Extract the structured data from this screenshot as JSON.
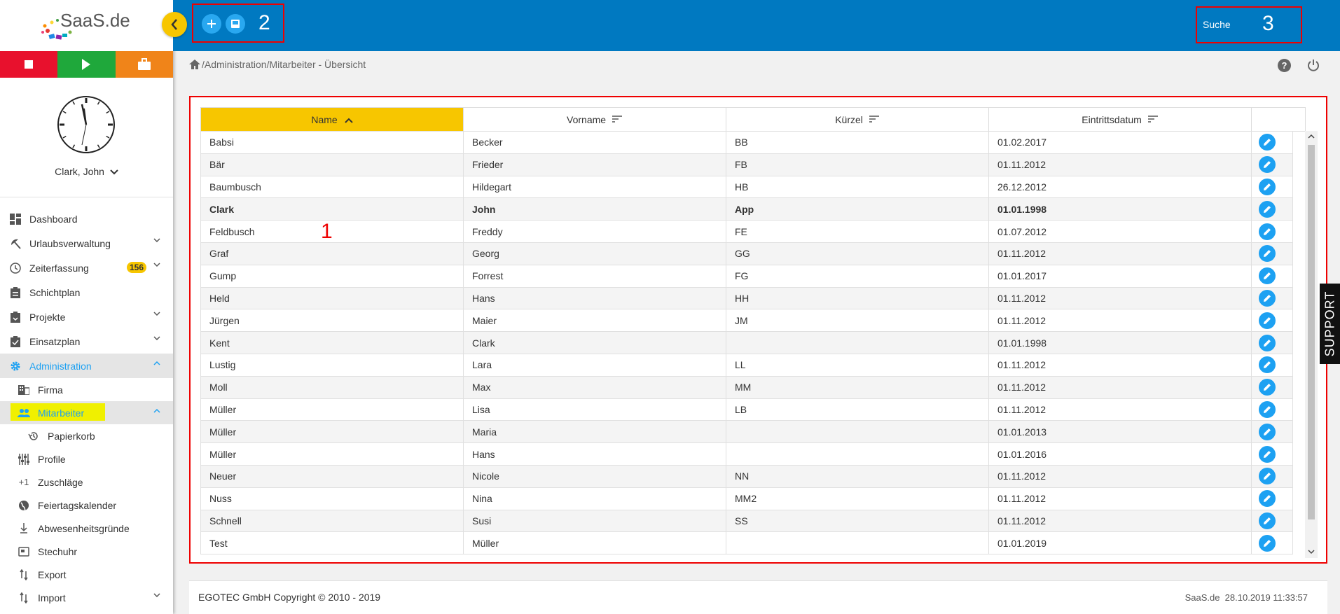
{
  "app": {
    "logo_text": "SaaS.de"
  },
  "user": {
    "name": "Clark, John"
  },
  "nav": {
    "items": [
      {
        "label": "Dashboard"
      },
      {
        "label": "Urlaubsverwaltung"
      },
      {
        "label": "Zeiterfassung",
        "badge": "156"
      },
      {
        "label": "Schichtplan"
      },
      {
        "label": "Projekte"
      },
      {
        "label": "Einsatzplan"
      },
      {
        "label": "Administration"
      }
    ],
    "sub_items": [
      {
        "label": "Firma"
      },
      {
        "label": "Mitarbeiter"
      },
      {
        "label": "Papierkorb"
      },
      {
        "label": "Profile"
      },
      {
        "label": "Zuschläge"
      },
      {
        "label": "Feiertagskalender"
      },
      {
        "label": "Abwesenheitsgründe"
      },
      {
        "label": "Stechuhr"
      },
      {
        "label": "Export"
      },
      {
        "label": "Import"
      }
    ]
  },
  "topbar": {
    "marker_2": "2",
    "marker_3": "3",
    "search_placeholder": "Suche"
  },
  "breadcrumb": {
    "text": "/Administration/Mitarbeiter - Übersicht"
  },
  "table": {
    "marker_1": "1",
    "columns": [
      "Name",
      "Vorname",
      "Kürzel",
      "Eintrittsdatum"
    ],
    "rows": [
      [
        "Babsi",
        "Becker",
        "BB",
        "01.02.2017"
      ],
      [
        "Bär",
        "Frieder",
        "FB",
        "01.11.2012"
      ],
      [
        "Baumbusch",
        "Hildegart",
        "HB",
        "26.12.2012"
      ],
      [
        "Clark",
        "John",
        "App",
        "01.01.1998"
      ],
      [
        "Feldbusch",
        "Freddy",
        "FE",
        "01.07.2012"
      ],
      [
        "Graf",
        "Georg",
        "GG",
        "01.11.2012"
      ],
      [
        "Gump",
        "Forrest",
        "FG",
        "01.01.2017"
      ],
      [
        "Held",
        "Hans",
        "HH",
        "01.11.2012"
      ],
      [
        "Jürgen",
        "Maier",
        "JM",
        "01.11.2012"
      ],
      [
        "Kent",
        "Clark",
        "",
        "01.01.1998"
      ],
      [
        "Lustig",
        "Lara",
        "LL",
        "01.11.2012"
      ],
      [
        "Moll",
        "Max",
        "MM",
        "01.11.2012"
      ],
      [
        "Müller",
        "Lisa",
        "LB",
        "01.11.2012"
      ],
      [
        "Müller",
        "Maria",
        "",
        "01.01.2013"
      ],
      [
        "Müller",
        "Hans",
        "",
        "01.01.2016"
      ],
      [
        "Neuer",
        "Nicole",
        "NN",
        "01.11.2012"
      ],
      [
        "Nuss",
        "Nina",
        "MM2",
        "01.11.2012"
      ],
      [
        "Schnell",
        "Susi",
        "SS",
        "01.11.2012"
      ],
      [
        "Test",
        "Müller",
        "",
        "01.01.2019"
      ]
    ]
  },
  "support": {
    "label": "SUPPORT"
  },
  "footer": {
    "copyright": "EGOTEC GmbH Copyright © 2010 - 2019",
    "status": "SaaS.de  28.10.2019 11:33:57"
  },
  "colors": {
    "topbar": "#0079c1",
    "accent": "#f7c600",
    "link": "#1da1f2",
    "highlight": "#f0f000"
  }
}
